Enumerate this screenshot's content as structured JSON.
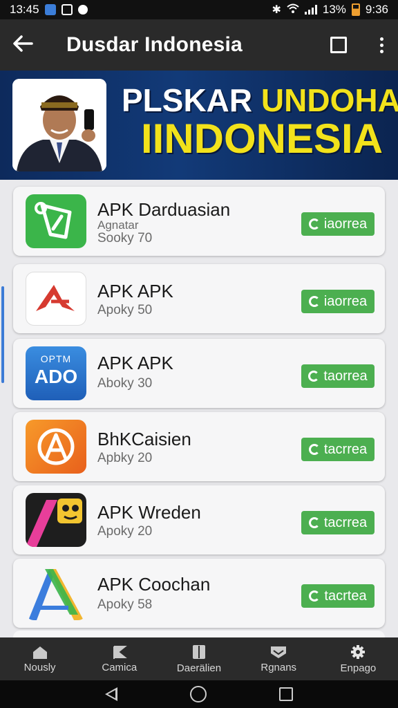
{
  "status_bar": {
    "time_left": "13:45",
    "battery_percent": "13%",
    "time_right": "9:36"
  },
  "app_bar": {
    "title": "Dusdar Indonesia"
  },
  "banner": {
    "line1_part1": "PLSKAR",
    "line1_part2": "UNDOHAAN",
    "line2": "IINDONESIA"
  },
  "apps": [
    {
      "name": "APK Darduasian",
      "sub1": "Agnatar",
      "sub2": "Sooky 70",
      "button": "iaorrea",
      "icon": "shield-leaf-icon"
    },
    {
      "name": "APK APK",
      "sub1": "Apoky 50",
      "button": "iaorrea",
      "icon": "red-triangle-logo-icon"
    },
    {
      "name": "APK APK",
      "icon_text_top": "OPTM",
      "icon_text_main": "ADO",
      "sub1": "Aboky 30",
      "button": "taorrea",
      "icon": "ado-logo-icon"
    },
    {
      "name": "BhKCaisien",
      "sub1": "Apbky 20",
      "button": "tacrrea",
      "icon": "orange-a-logo-icon"
    },
    {
      "name": "APK Wreden",
      "sub1": "Apoky 20",
      "button": "tacrrea",
      "icon": "owl-logo-icon"
    },
    {
      "name": "APK Coochan",
      "sub1": "Apoky 58",
      "button": "tacrtea",
      "icon": "color-a-logo-icon"
    }
  ],
  "bottom_nav": [
    {
      "label": "Nously",
      "icon": "home-icon"
    },
    {
      "label": "Camica",
      "icon": "flag-icon"
    },
    {
      "label": "Daerälien",
      "icon": "book-icon"
    },
    {
      "label": "Rgnans",
      "icon": "inbox-icon"
    },
    {
      "label": "Enpago",
      "icon": "gear-icon"
    }
  ],
  "colors": {
    "install_green": "#4caf50",
    "banner_yellow": "#f2e21b",
    "banner_blue": "#123a78"
  }
}
